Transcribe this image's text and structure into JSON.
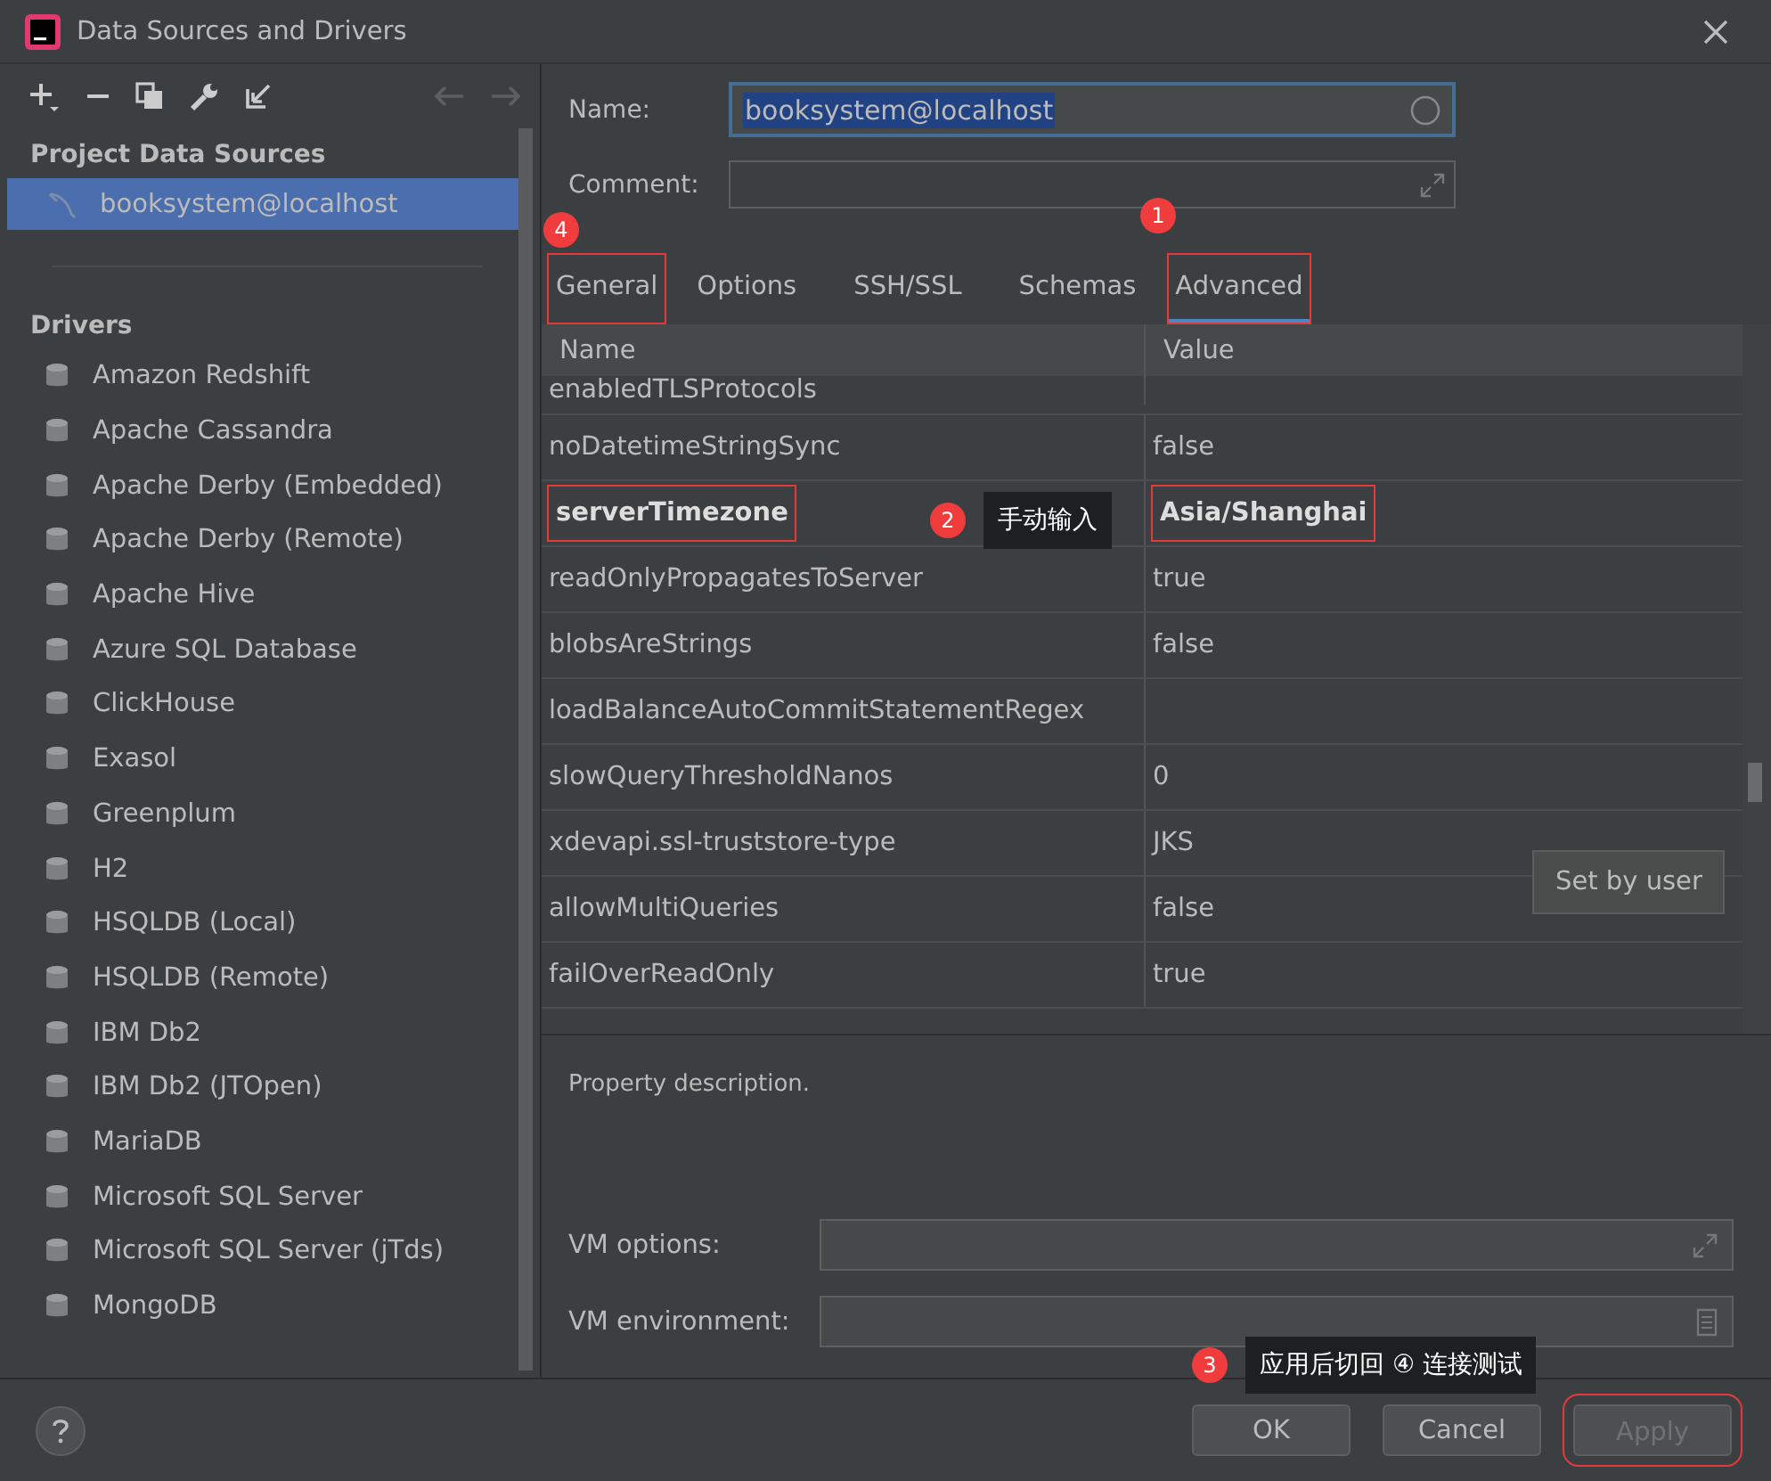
{
  "window": {
    "title": "Data Sources and Drivers"
  },
  "sidebar": {
    "project_header": "Project Data Sources",
    "project_items": [
      {
        "label": "booksystem@localhost",
        "selected": true
      }
    ],
    "drivers_header": "Drivers",
    "drivers": [
      {
        "label": "Amazon Redshift"
      },
      {
        "label": "Apache Cassandra"
      },
      {
        "label": "Apache Derby (Embedded)"
      },
      {
        "label": "Apache Derby (Remote)"
      },
      {
        "label": "Apache Hive"
      },
      {
        "label": "Azure SQL Database"
      },
      {
        "label": "ClickHouse"
      },
      {
        "label": "Exasol"
      },
      {
        "label": "Greenplum"
      },
      {
        "label": "H2"
      },
      {
        "label": "HSQLDB (Local)"
      },
      {
        "label": "HSQLDB (Remote)"
      },
      {
        "label": "IBM Db2"
      },
      {
        "label": "IBM Db2 (JTOpen)"
      },
      {
        "label": "MariaDB"
      },
      {
        "label": "Microsoft SQL Server"
      },
      {
        "label": "Microsoft SQL Server (jTds)"
      },
      {
        "label": "MongoDB"
      }
    ]
  },
  "form": {
    "name_label": "Name:",
    "name_value": "booksystem@localhost",
    "comment_label": "Comment:"
  },
  "tabs": [
    {
      "label": "General",
      "selected": false,
      "highlighted": true
    },
    {
      "label": "Options",
      "selected": false,
      "highlighted": false
    },
    {
      "label": "SSH/SSL",
      "selected": false,
      "highlighted": false
    },
    {
      "label": "Schemas",
      "selected": false,
      "highlighted": false
    },
    {
      "label": "Advanced",
      "selected": true,
      "highlighted": true
    }
  ],
  "table": {
    "columns": [
      "Name",
      "Value"
    ],
    "rows": [
      {
        "name": "enabledTLSProtocols",
        "value": "",
        "modified": false,
        "highlighted": false
      },
      {
        "name": "noDatetimeStringSync",
        "value": "false",
        "modified": false,
        "highlighted": false
      },
      {
        "name": "serverTimezone",
        "value": "Asia/Shanghai",
        "modified": true,
        "highlighted": true
      },
      {
        "name": "readOnlyPropagatesToServer",
        "value": "true",
        "modified": false,
        "highlighted": false
      },
      {
        "name": "blobsAreStrings",
        "value": "false",
        "modified": false,
        "highlighted": false
      },
      {
        "name": "loadBalanceAutoCommitStatementRegex",
        "value": "",
        "modified": false,
        "highlighted": false
      },
      {
        "name": "slowQueryThresholdNanos",
        "value": "0",
        "modified": false,
        "highlighted": false
      },
      {
        "name": "xdevapi.ssl-truststore-type",
        "value": "JKS",
        "modified": false,
        "highlighted": false
      },
      {
        "name": "allowMultiQueries",
        "value": "false",
        "modified": false,
        "highlighted": false
      },
      {
        "name": "failOverReadOnly",
        "value": "true",
        "modified": false,
        "highlighted": false
      }
    ],
    "tooltip": "Set by user"
  },
  "description": "Property description.",
  "vm": {
    "options_label": "VM options:",
    "environment_label": "VM environment:"
  },
  "buttons": [
    {
      "label": "OK",
      "disabled": false,
      "highlighted": false
    },
    {
      "label": "Cancel",
      "disabled": false,
      "highlighted": false
    },
    {
      "label": "Apply",
      "disabled": true,
      "highlighted": true
    }
  ],
  "annotations": [
    {
      "number": "1"
    },
    {
      "number": "4"
    },
    {
      "number": "2",
      "note": "手动输入"
    },
    {
      "number": "3",
      "note": "应用后切回 ④ 连接测试"
    }
  ]
}
